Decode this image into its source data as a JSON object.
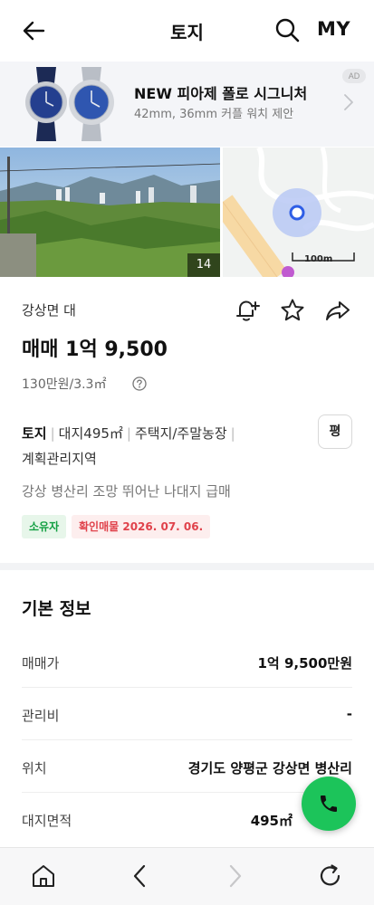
{
  "header": {
    "title": "토지",
    "my_label": "MY"
  },
  "ad": {
    "title": "NEW 피아제 폴로 시그니처",
    "subtitle": "42mm, 36mm 커플 워치 제안",
    "badge": "AD"
  },
  "photos": {
    "count": "14",
    "map_scale": "100m"
  },
  "listing": {
    "subtitle": "강상면 대",
    "price": "매매 1억 9,500",
    "unit_price": "130만원/3.3㎡",
    "tags": [
      "토지",
      "대지495㎡",
      "주택지/주말농장"
    ],
    "zone": "계획관리지역",
    "area_unit_button": "평",
    "description": "강상 병산리 조망 뛰어난 나대지 급매",
    "badge_owner": "소유자",
    "badge_verified": "확인매물 2026. 07. 06."
  },
  "basic_info": {
    "title": "기본 정보",
    "rows": [
      {
        "label": "매매가",
        "value": "1억 9,500만원"
      },
      {
        "label": "관리비",
        "value": "-"
      },
      {
        "label": "위치",
        "value": "경기도 양평군 강상면 병산리"
      },
      {
        "label": "대지면적",
        "value": "495㎡"
      }
    ]
  },
  "colors": {
    "accent_green": "#1cc45a",
    "owner_green": "#13a043",
    "verify_red": "#e0424b"
  }
}
